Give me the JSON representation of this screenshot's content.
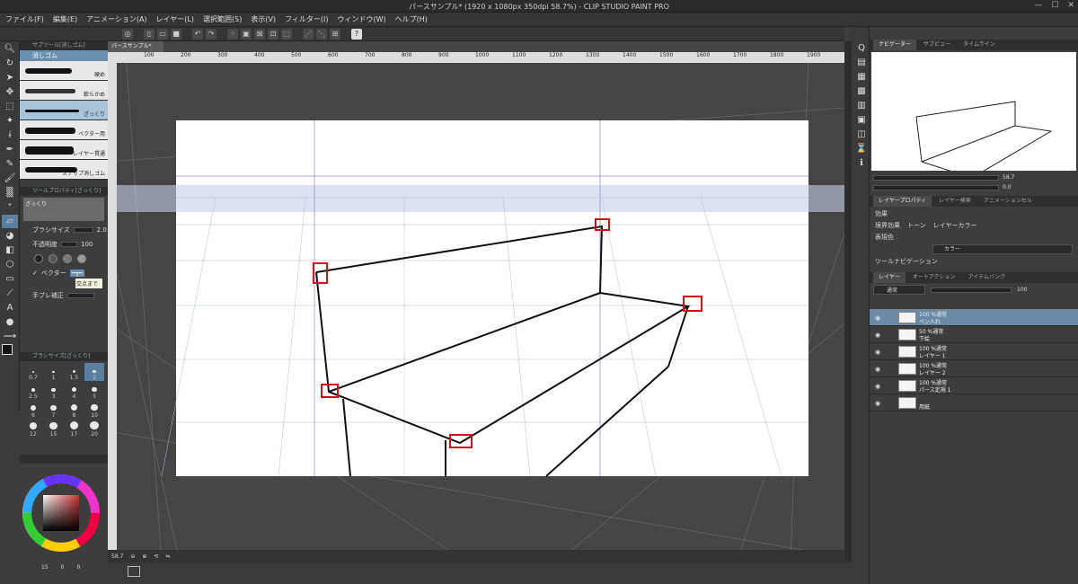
{
  "window": {
    "title": "パースサンプル* (1920 x 1080px 350dpi 58.7%) - CLIP STUDIO PAINT PRO"
  },
  "menu": [
    "ファイル(F)",
    "編集(E)",
    "アニメーション(A)",
    "レイヤー(L)",
    "選択範囲(S)",
    "表示(V)",
    "フィルター(I)",
    "ウィンドウ(W)",
    "ヘルプ(H)"
  ],
  "document_tab": "パースサンプル*",
  "ruler_ticks": [
    "100",
    "200",
    "300",
    "400",
    "500",
    "600",
    "700",
    "800",
    "900",
    "1000",
    "1100",
    "1200",
    "1300",
    "1400",
    "1500",
    "1600",
    "1700",
    "1800",
    "1900"
  ],
  "subtool": {
    "header": "サブツール[消しゴム]",
    "tab": "消しゴム",
    "brushes": [
      "硬め",
      "軟らかめ",
      "ざっくり",
      "ベクター用",
      "レイヤー貫通",
      "スナップ消しゴム"
    ],
    "selected": "ざっくり"
  },
  "tool_property": {
    "header": "ツールプロパティ[ざっくり]",
    "name": "ざっくり",
    "brush_size_label": "ブラシサイズ",
    "brush_size_value": "2.0",
    "opacity_label": "不透明度",
    "opacity_value": "100",
    "vector_label": "ベクター",
    "tooltip": "交点まで",
    "stabilization_label": "手ブレ補正"
  },
  "brush_size_panel": {
    "header": "ブラシサイズ[ざっくり]",
    "sizes": [
      "0.7",
      "1",
      "1.5",
      "2",
      "2.5",
      "3",
      "4",
      "5",
      "6",
      "7",
      "8",
      "10",
      "12",
      "15",
      "17",
      "20"
    ],
    "selected": "2"
  },
  "color_bottom": {
    "values": [
      "15",
      "0",
      "0"
    ]
  },
  "statusbar": {
    "zoom": "58.7"
  },
  "navigator": {
    "tabs": [
      "ナビゲーター",
      "サブビュー",
      "タイムライン"
    ],
    "zoom": "58.7",
    "angle": "0.0"
  },
  "layer_property": {
    "tabs": [
      "レイヤープロパティ",
      "レイヤー検索",
      "アニメーションセル"
    ],
    "effect_label": "効果",
    "effects": [
      "境界効果",
      "トーン",
      "レイヤーカラー"
    ],
    "expression_label": "表現色",
    "expression_value": "カラー",
    "tool_nav_label": "ツールナビゲーション"
  },
  "layers": {
    "tabs": [
      "レイヤー",
      "オートアクション",
      "アイテムバンク"
    ],
    "blend_mode": "通常",
    "opacity": "100",
    "items": [
      {
        "line1": "100 %通常",
        "line2": "ペン入れ",
        "selected": true
      },
      {
        "line1": "50 %通常",
        "line2": "下絵",
        "selected": false
      },
      {
        "line1": "100 %通常",
        "line2": "レイヤー 1",
        "selected": false
      },
      {
        "line1": "100 %通常",
        "line2": "レイヤー 2",
        "selected": false
      },
      {
        "line1": "100 %通常",
        "line2": "パース定規 1",
        "selected": false
      },
      {
        "line1": "",
        "line2": "用紙",
        "selected": false
      }
    ]
  }
}
